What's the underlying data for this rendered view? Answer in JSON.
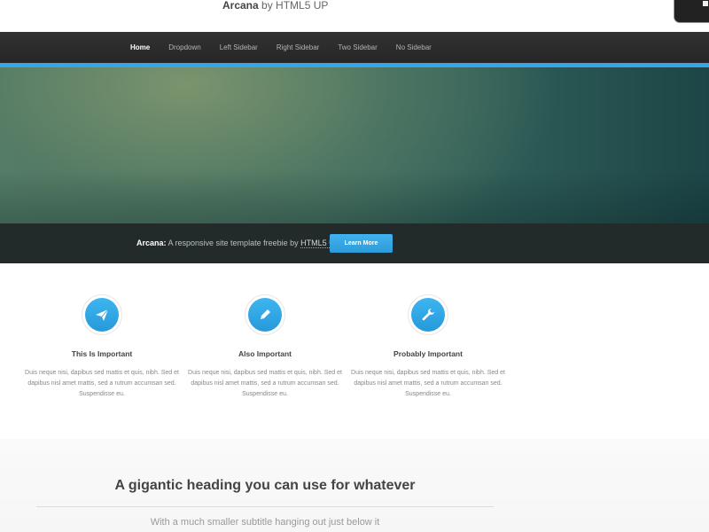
{
  "header": {
    "logo_brand": "Arcana",
    "logo_suffix": " by HTML5 UP"
  },
  "nav": {
    "items": [
      "Home",
      "Dropdown",
      "Left Sidebar",
      "Right Sidebar",
      "Two Sidebar",
      "No Sidebar"
    ],
    "active_index": 0
  },
  "banner": {
    "brand": "Arcana:",
    "text": " A responsive site template freebie by ",
    "link": "HTML5 UP",
    "button_label": "Learn More"
  },
  "features": [
    {
      "icon": "paper-plane-icon",
      "title": "This Is Important",
      "text": "Duis neque nisi, dapibus sed mattis et quis, nibh. Sed et dapibus nisl amet mattis, sed a rutrum accumsan sed. Suspendisse eu."
    },
    {
      "icon": "pencil-icon",
      "title": "Also Important",
      "text": "Duis neque nisi, dapibus sed mattis et quis, nibh. Sed et dapibus nisl amet mattis, sed a rutrum accumsan sed. Suspendisse eu."
    },
    {
      "icon": "wrench-icon",
      "title": "Probably Important",
      "text": "Duis neque nisi, dapibus sed mattis et quis, nibh. Sed et dapibus nisl amet mattis, sed a rutrum accumsan sed. Suspendisse eu."
    }
  ],
  "lower": {
    "heading": "A gigantic heading you can use for whatever",
    "subtitle": "With a much smaller subtitle hanging out just below it"
  },
  "colors": {
    "accent": "#37a6e8",
    "nav_background": "#2c2c2c",
    "banner_bar": "#232b2a"
  }
}
